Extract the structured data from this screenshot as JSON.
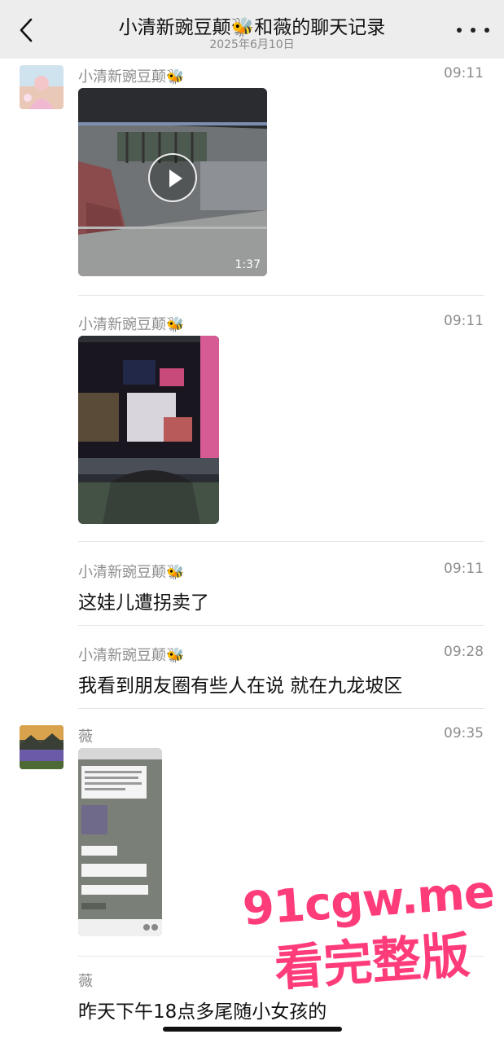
{
  "header": {
    "title": "小清新豌豆颠🐝和薇的聊天记录",
    "date": "2025年6月10日"
  },
  "messages": [
    {
      "sender": "小清新豌豆颠🐝",
      "time": "09:11",
      "type": "video",
      "duration": "1:37"
    },
    {
      "sender": "小清新豌豆颠🐝",
      "time": "09:11",
      "type": "image"
    },
    {
      "sender": "小清新豌豆颠🐝",
      "time": "09:11",
      "type": "text",
      "text": "这娃儿遭拐卖了"
    },
    {
      "sender": "小清新豌豆颠🐝",
      "time": "09:28",
      "type": "text",
      "text": "我看到朋友圈有些人在说 就在九龙坡区"
    },
    {
      "sender": "薇",
      "time": "09:35",
      "type": "image"
    },
    {
      "sender": "薇",
      "time": "",
      "type": "text",
      "text": "昨天下午18点多尾随小女孩的"
    }
  ],
  "watermark": {
    "line1": "91cgw.me",
    "line2": "看完整版"
  }
}
